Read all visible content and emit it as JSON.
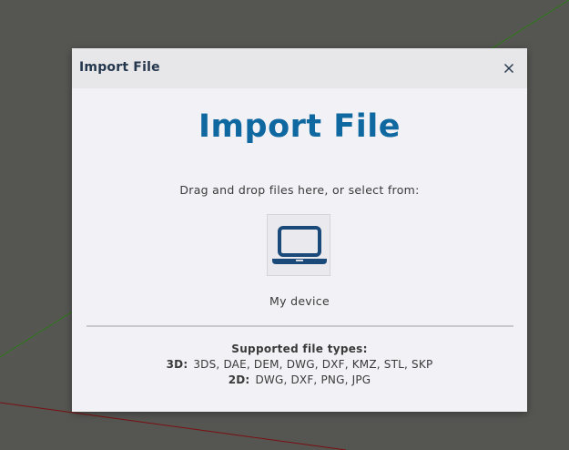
{
  "dialog": {
    "title": "Import File",
    "close_icon": "close-icon",
    "heading": "Import File",
    "instructions": "Drag and drop files here, or select from:",
    "source": {
      "icon": "laptop-icon",
      "label": "My device"
    },
    "supported": {
      "title": "Supported file types:",
      "rows": [
        {
          "label": "3D:",
          "formats": "3DS, DAE, DEM, DWG, DXF, KMZ, STL, SKP"
        },
        {
          "label": "2D:",
          "formats": "DWG, DXF, PNG, JPG"
        }
      ]
    }
  },
  "colors": {
    "viewport_background": "#555552",
    "heading": "#0f68a0",
    "icon": "#1a4a7a",
    "green_axis": "#2f7a1a",
    "red_axis": "#7a1010"
  }
}
